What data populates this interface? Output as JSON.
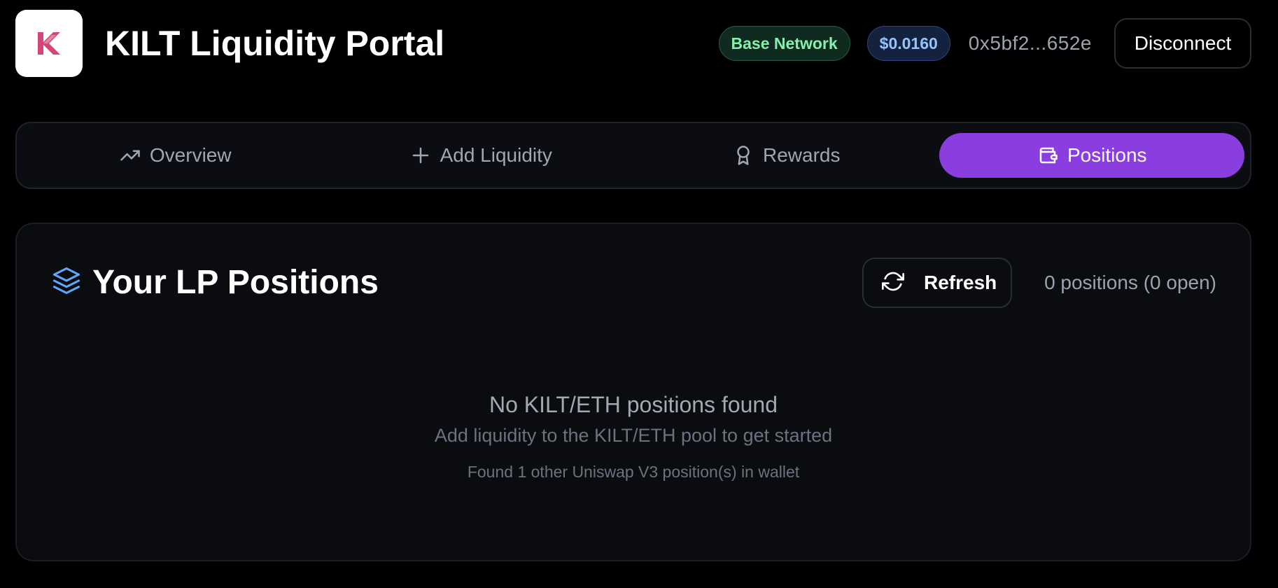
{
  "header": {
    "logo_letter": "K",
    "title": "KILT Liquidity Portal",
    "network_badge": "Base Network",
    "price_badge": "$0.0160",
    "wallet_address": "0x5bf2...652e",
    "disconnect_label": "Disconnect"
  },
  "tabs": [
    {
      "label": "Overview",
      "icon": "trending-up-icon",
      "active": false
    },
    {
      "label": "Add Liquidity",
      "icon": "plus-icon",
      "active": false
    },
    {
      "label": "Rewards",
      "icon": "award-icon",
      "active": false
    },
    {
      "label": "Positions",
      "icon": "wallet-icon",
      "active": true
    }
  ],
  "main": {
    "title": "Your LP Positions",
    "title_icon": "layers-icon",
    "refresh_label": "Refresh",
    "positions_count": "0 positions (0 open)",
    "empty_title": "No KILT/ETH positions found",
    "empty_subtitle": "Add liquidity to the KILT/ETH pool to get started",
    "empty_note": "Found 1 other Uniswap V3 position(s) in wallet"
  },
  "colors": {
    "background": "#000000",
    "accent_purple": "#8a3ee0",
    "logo_pink": "#d6457a",
    "network_green": "#86efac",
    "price_blue": "#93c5fd",
    "layers_blue": "#60a5fa"
  }
}
